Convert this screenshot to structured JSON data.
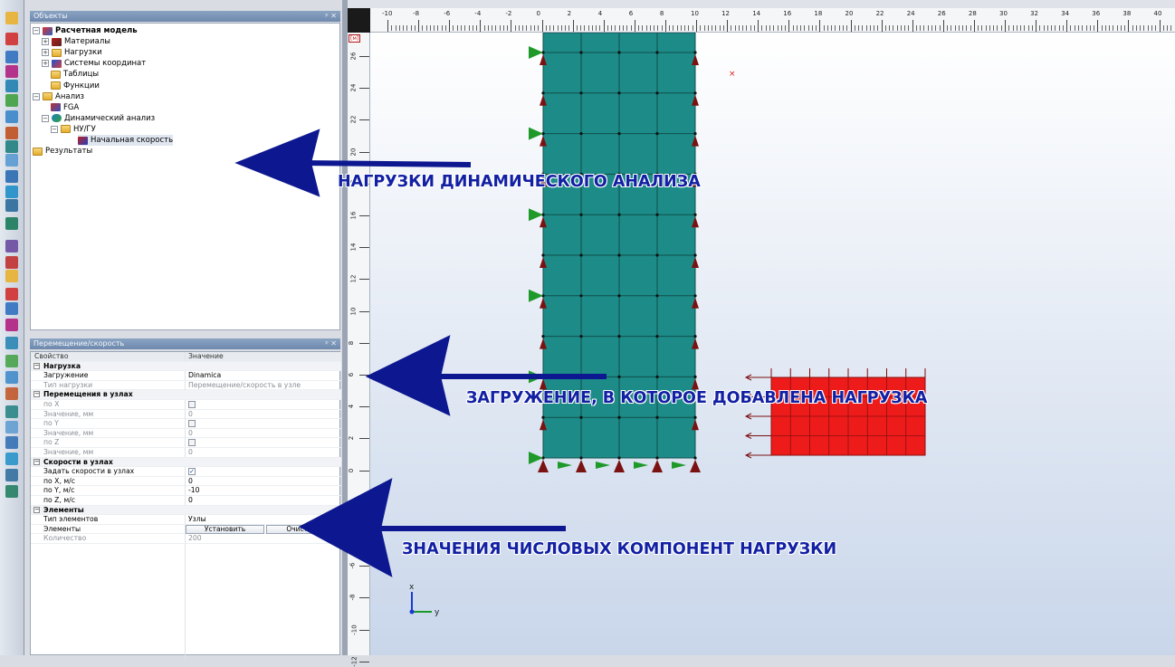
{
  "objects_panel": {
    "title": "Объекты",
    "pin": "ᵖ ✕",
    "tree": [
      {
        "label": "Расчетная модель",
        "bold": true
      },
      {
        "label": "Материалы"
      },
      {
        "label": "Нагрузки"
      },
      {
        "label": "Системы координат"
      },
      {
        "label": "Таблицы"
      },
      {
        "label": "Функции"
      },
      {
        "label": "Анализ"
      },
      {
        "label": "FGA"
      },
      {
        "label": "Динамический анализ"
      },
      {
        "label": "НУ/ГУ"
      },
      {
        "label": "Начальная скорость"
      },
      {
        "label": "Результаты"
      }
    ]
  },
  "props_panel": {
    "title": "Перемещение/скорость",
    "pin": "ᵖ ✕",
    "col_property": "Свойство",
    "col_value": "Значение",
    "rows": [
      {
        "type": "group",
        "label": "Нагрузка"
      },
      {
        "type": "row",
        "label": "Загружение",
        "value": "Dinamica"
      },
      {
        "type": "row",
        "label": "Тип нагрузки",
        "value": "Перемещение/скорость в узле",
        "dim": true
      },
      {
        "type": "group",
        "label": "Перемещения в узлах"
      },
      {
        "type": "check",
        "label": "по X",
        "checked": false,
        "dim": true
      },
      {
        "type": "row",
        "label": "Значение, мм",
        "value": "0",
        "dim": true
      },
      {
        "type": "check",
        "label": "по Y",
        "checked": false,
        "dim": true
      },
      {
        "type": "row",
        "label": "Значение, мм",
        "value": "0",
        "dim": true
      },
      {
        "type": "check",
        "label": "по Z",
        "checked": false,
        "dim": true
      },
      {
        "type": "row",
        "label": "Значение, мм",
        "value": "0",
        "dim": true
      },
      {
        "type": "group",
        "label": "Скорости в узлах"
      },
      {
        "type": "check",
        "label": "Задать скорости в узлах",
        "checked": true
      },
      {
        "type": "row",
        "label": "по X, м/с",
        "value": "0"
      },
      {
        "type": "row",
        "label": "по Y, м/с",
        "value": "-10"
      },
      {
        "type": "row",
        "label": "по Z, м/с",
        "value": "0"
      },
      {
        "type": "group",
        "label": "Элементы"
      },
      {
        "type": "select",
        "label": "Тип элементов",
        "value": "Узлы"
      },
      {
        "type": "buttons",
        "label": "Элементы",
        "btn1": "Установить",
        "btn2": "Очистить"
      },
      {
        "type": "row",
        "label": "Количество",
        "value": "200",
        "dim": true
      }
    ]
  },
  "ruler": {
    "top_ticks": [
      "-10",
      "-8",
      "-6",
      "-4",
      "-2",
      "0",
      "2",
      "4",
      "6",
      "8",
      "10",
      "12",
      "14",
      "16",
      "18",
      "20",
      "22",
      "24",
      "26",
      "28",
      "30",
      "32",
      "34",
      "36",
      "38",
      "40"
    ],
    "left_ticks": [
      "26",
      "24",
      "22",
      "20",
      "18",
      "16",
      "14",
      "12",
      "10",
      "8",
      "6",
      "4",
      "2",
      "0",
      "-2",
      "-4",
      "-6",
      "-8",
      "-10",
      "-12"
    ],
    "unit": "[м]"
  },
  "axes": {
    "x": "x",
    "y": "y"
  },
  "annotations": {
    "a1": "НАГРУЗКИ ДИНАМИЧЕСКОГО АНАЛИЗА",
    "a2": "ЗАГРУЖЕНИЕ, В КОТОРОЕ ДОБАВЛЕНА НАГРУЗКА",
    "a3": "ЗНАЧЕНИЯ ЧИСЛОВЫХ КОМПОНЕНТ НАГРУЗКИ"
  },
  "colors": {
    "mesh": "#1d8b87",
    "load_block": "#ee1b1b",
    "arrow": "#0d1890",
    "support": "#7a1212",
    "bc": "#1f9a2a"
  }
}
